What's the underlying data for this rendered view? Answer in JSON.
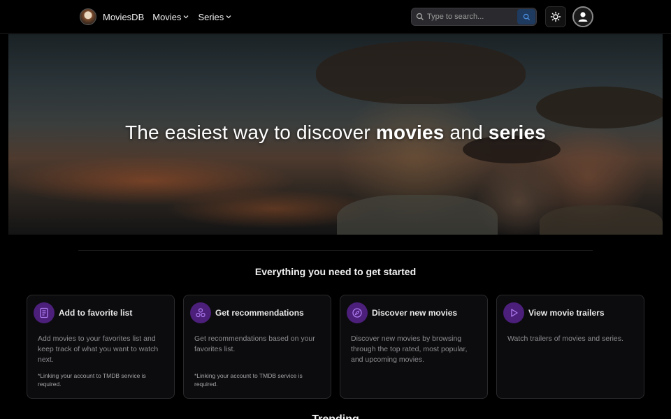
{
  "navbar": {
    "brand": "MoviesDB",
    "menus": [
      {
        "label": "Movies"
      },
      {
        "label": "Series"
      }
    ],
    "search_placeholder": "Type to search..."
  },
  "hero": {
    "title_part1": "The easiest way to discover ",
    "title_bold1": "movies",
    "title_part2": " and ",
    "title_bold2": "series"
  },
  "section_title": "Everything you need to get started",
  "cards": [
    {
      "icon": "list-icon",
      "title": "Add to favorite list",
      "description": "Add movies to your favorites list and keep track of what you want to watch next.",
      "note": "*Linking your account to TMDB service is required."
    },
    {
      "icon": "recommendations-icon",
      "title": "Get recommendations",
      "description": "Get recommendations based on your favorites list.",
      "note": "*Linking your account to TMDB service is required."
    },
    {
      "icon": "compass-icon",
      "title": "Discover new movies",
      "description": "Discover new movies by browsing through the top rated, most popular, and upcoming movies.",
      "note": ""
    },
    {
      "icon": "play-icon",
      "title": "View movie trailers",
      "description": "Watch trailers of movies and series.",
      "note": ""
    }
  ],
  "trending_title": "Trending",
  "colors": {
    "accent": "#4b1f7a",
    "accent_icon": "#b07cf0",
    "background": "#000000",
    "card_border": "#2a2a2d"
  }
}
